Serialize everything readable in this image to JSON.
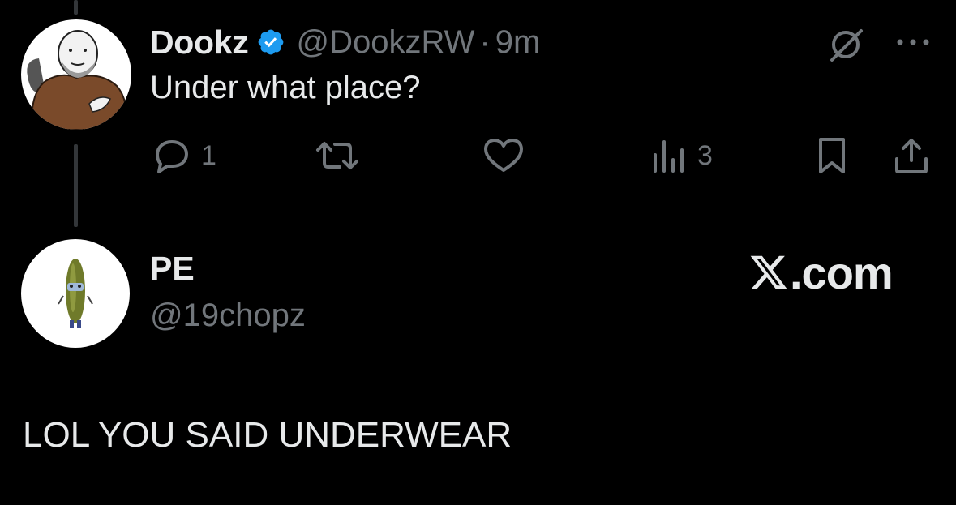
{
  "original_tweet": {
    "author": {
      "display_name": "Dookz",
      "verified": true,
      "handle": "@DookzRW",
      "avatar_icon": "wojak-cartoon-avatar"
    },
    "separator": "·",
    "time": "9m",
    "text": "Under what place?",
    "actions": {
      "reply_count": "1",
      "retweet_count": "",
      "like_count": "",
      "views_count": "3"
    }
  },
  "reply_tweet": {
    "author": {
      "display_name": "PE",
      "handle": "@19chopz",
      "avatar_icon": "pickle-character-avatar"
    },
    "text": "LOL YOU SAID UNDERWEAR"
  },
  "watermark": {
    "text": ".com",
    "icon": "x-logo-icon"
  },
  "colors": {
    "background": "#000000",
    "primary_text": "#e7e9ea",
    "secondary_text": "#71767b",
    "verified_blue": "#1d9bf0",
    "thread_line": "#333639"
  }
}
